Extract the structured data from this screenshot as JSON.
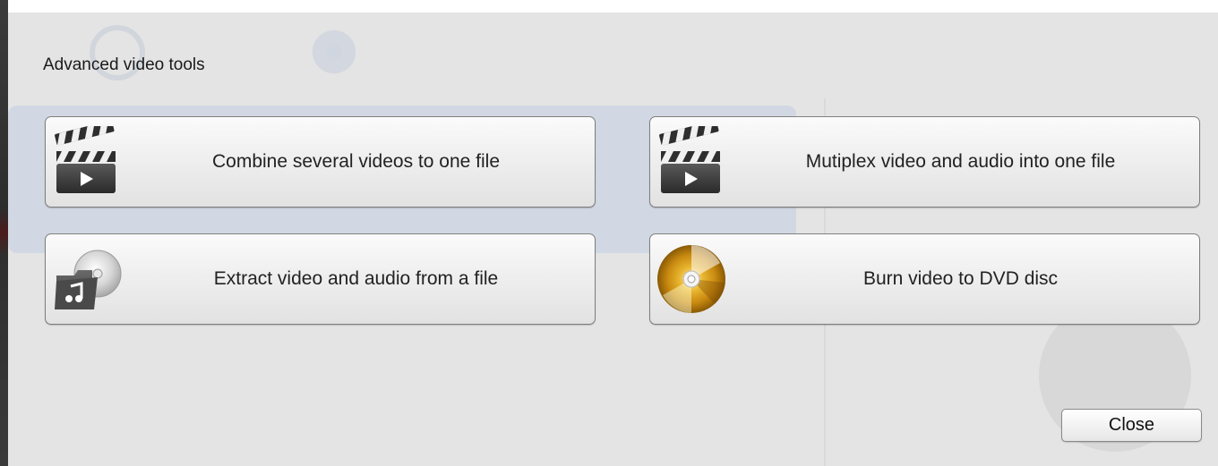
{
  "dialog": {
    "title": "Advanced video tools",
    "close_label": "Close"
  },
  "tools": [
    {
      "label": "Combine several videos to one file",
      "icon": "clapperboard-icon"
    },
    {
      "label": "Mutiplex video and audio into one file",
      "icon": "clapperboard-icon"
    },
    {
      "label": "Extract video and audio from a file",
      "icon": "music-folder-disc-icon"
    },
    {
      "label": "Burn video to DVD disc",
      "icon": "dvd-disc-icon"
    }
  ],
  "colors": {
    "sheet_background": "#e4e4e4",
    "button_border": "#7e7e7e",
    "clapper_dark": "#3a3a3a",
    "disc_gold": "#d9a21a"
  }
}
